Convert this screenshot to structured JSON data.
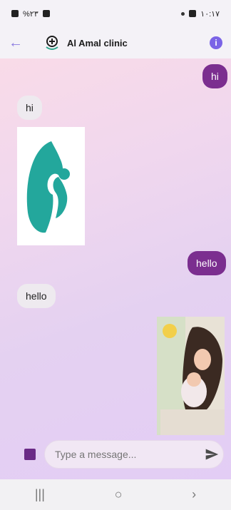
{
  "status": {
    "left_text": "%٢٣",
    "time": "١٠:١٧"
  },
  "header": {
    "title": "Al Amal clinic"
  },
  "messages": [
    {
      "dir": "out",
      "text": "hi"
    },
    {
      "dir": "in",
      "text": "hi"
    },
    {
      "dir": "in",
      "type": "image",
      "alt": "mother and baby silhouette logo"
    },
    {
      "dir": "out",
      "text": "hello"
    },
    {
      "dir": "in",
      "text": "hello"
    },
    {
      "dir": "out",
      "type": "image",
      "alt": "mother holding baby photo"
    }
  ],
  "composer": {
    "placeholder": "Type a message..."
  },
  "colors": {
    "accent": "#7b2e8f",
    "info": "#7a63e6"
  }
}
